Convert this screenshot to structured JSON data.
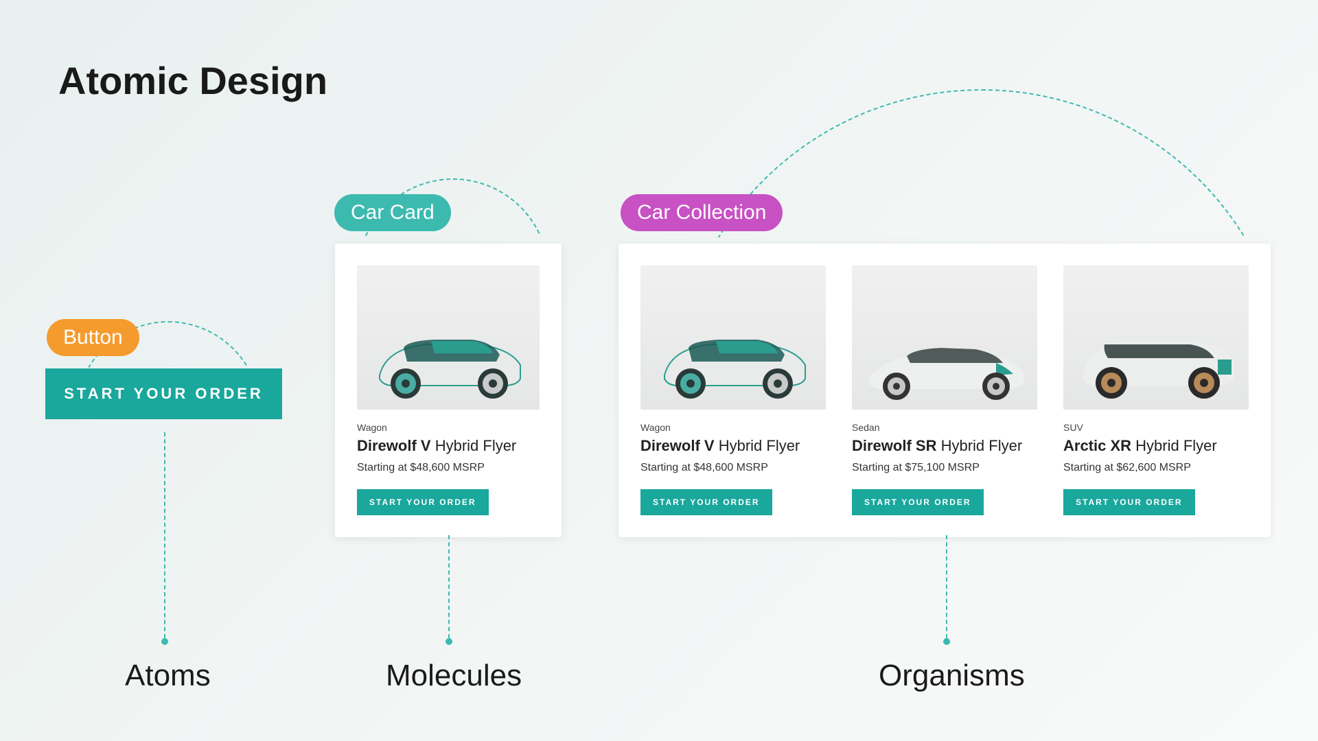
{
  "title": "Atomic Design",
  "pills": {
    "button": "Button",
    "card": "Car Card",
    "collection": "Car Collection"
  },
  "big_button_label": "START YOUR ORDER",
  "single_card": {
    "type": "Wagon",
    "name_bold": "Direwolf V",
    "name_rest": " Hybrid Flyer",
    "price": "Starting at $48,600 MSRP",
    "button": "START YOUR ORDER"
  },
  "collection": [
    {
      "type": "Wagon",
      "name_bold": "Direwolf V",
      "name_rest": " Hybrid Flyer",
      "price": "Starting at $48,600 MSRP",
      "button": "START YOUR ORDER"
    },
    {
      "type": "Sedan",
      "name_bold": "Direwolf SR",
      "name_rest": " Hybrid Flyer",
      "price": "Starting at $75,100 MSRP",
      "button": "START YOUR ORDER"
    },
    {
      "type": "SUV",
      "name_bold": "Arctic XR",
      "name_rest": " Hybrid Flyer",
      "price": "Starting at $62,600 MSRP",
      "button": "START YOUR ORDER"
    }
  ],
  "sections": {
    "atoms": "Atoms",
    "molecules": "Molecules",
    "organisms": "Organisms"
  },
  "colors": {
    "teal": "#1aa79c",
    "teal_light": "#3dbab0",
    "orange": "#f59b2e",
    "magenta": "#c851c3"
  }
}
